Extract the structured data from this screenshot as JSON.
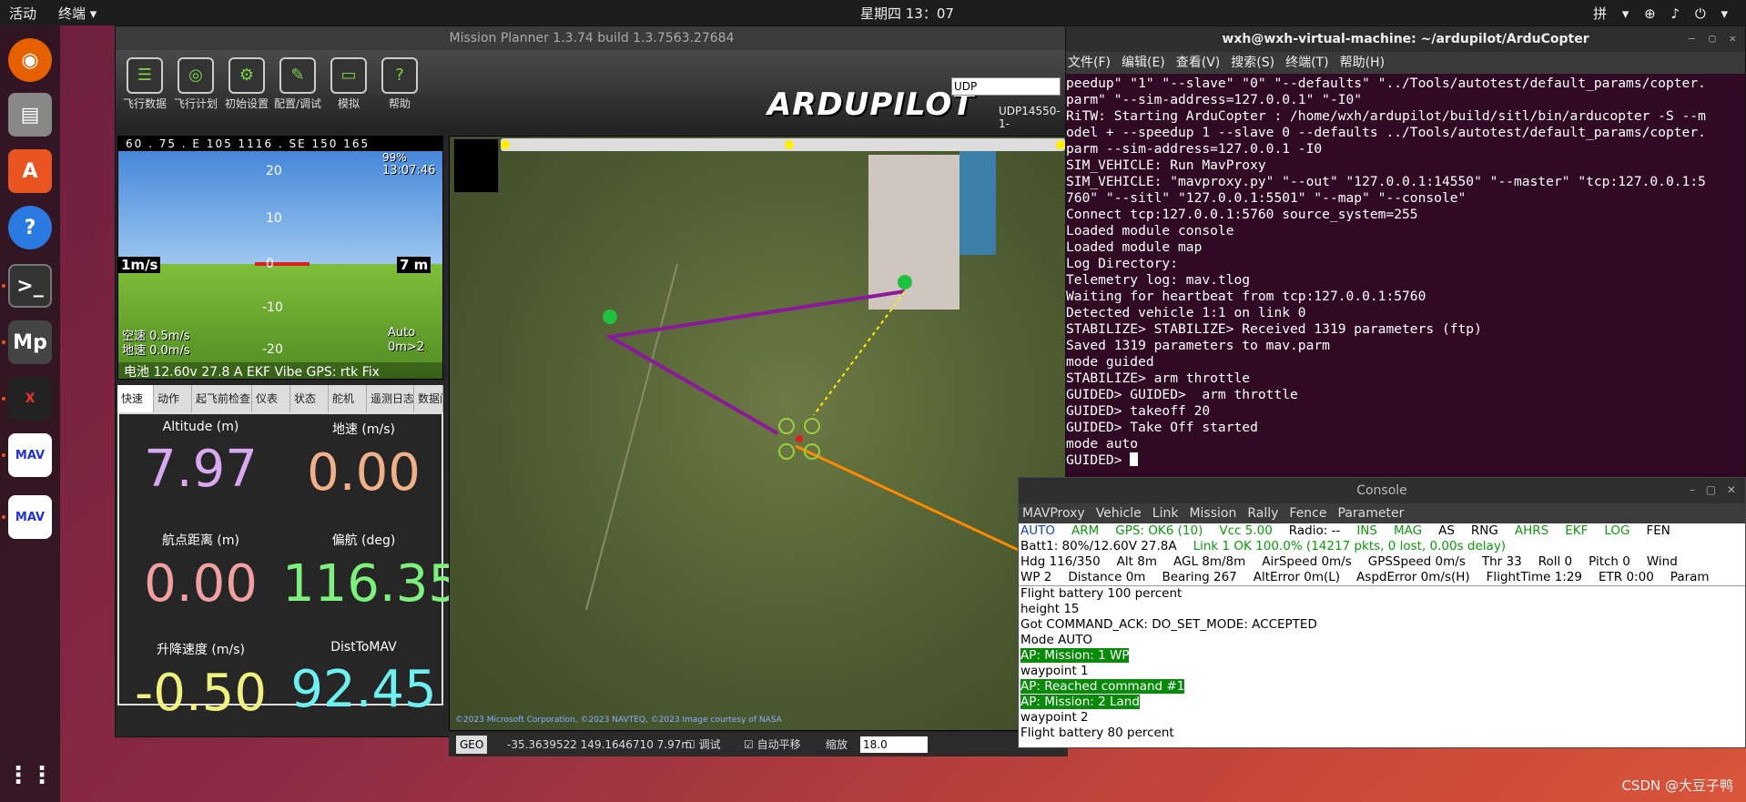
{
  "topbar": {
    "activities": "活动",
    "app": "终端 ▾",
    "clock": "星期四 13：07",
    "right": "拼 ▾  ⊕  ♪  ⏻ ▾"
  },
  "mp": {
    "title": "Mission Planner 1.3.74 build 1.3.7563.27684",
    "toolbar": [
      {
        "label": "飞行数据",
        "icon": "flight-data-icon"
      },
      {
        "label": "飞行计划",
        "icon": "flight-plan-icon"
      },
      {
        "label": "初始设置",
        "icon": "initial-setup-icon"
      },
      {
        "label": "配置/调试",
        "icon": "config-tuning-icon"
      },
      {
        "label": "模拟",
        "icon": "simulation-icon"
      },
      {
        "label": "帮助",
        "icon": "help-icon"
      }
    ],
    "logo": "ARDUPILOT",
    "conn_type": "UDP",
    "port": "UDP14550-1-"
  },
  "hud": {
    "compass": "60 . 75 . E 105 1116 . SE 150 165",
    "time": "13:07:46",
    "percent": "99%",
    "left_box": "1m/s",
    "right_box": "7 m",
    "airspeed": "空速 0.5m/s",
    "groundspeed": "地速 0.0m/s",
    "mode": "Auto",
    "wp": "0m>2",
    "bottom": "电池 12.60v 27.8 A EKF Vibe GPS: rtk Fix",
    "pitch_labels": [
      "20",
      "10",
      "0",
      "-10",
      "-20"
    ]
  },
  "tabs": [
    "快速",
    "动作",
    "起飞前检查",
    "仪表",
    "状态",
    "舵机",
    "遥测日志",
    "数据闪存"
  ],
  "quick": [
    {
      "label": "Altitude (m)",
      "value": "7.97",
      "color": "#d8a8f0"
    },
    {
      "label": "地速 (m/s)",
      "value": "0.00",
      "color": "#f0b088"
    },
    {
      "label": "航点距离 (m)",
      "value": "0.00",
      "color": "#f0a0a0"
    },
    {
      "label": "偏航 (deg)",
      "value": "116.35",
      "color": "#7ef07e"
    },
    {
      "label": "升降速度 (m/s)",
      "value": "-0.50",
      "color": "#f0f080"
    },
    {
      "label": "DistToMAV",
      "value": "92.45",
      "color": "#6ef0f0"
    }
  ],
  "map": {
    "attribution": "©2023 Microsoft Corporation, ©2023 NAVTEQ, ©2023 Image courtesy of NASA",
    "status": {
      "geo": "GEO",
      "coords": "-35.3639522 149.1646710  7.97m",
      "debug": "调试",
      "autopan": "自动平移",
      "zoom_label": "缩放",
      "zoom": "18.0"
    }
  },
  "terminal": {
    "title": "wxh@wxh-virtual-machine: ~/ardupilot/ArduCopter",
    "menu": [
      "文件(F)",
      "编辑(E)",
      "查看(V)",
      "搜索(S)",
      "终端(T)",
      "帮助(H)"
    ],
    "lines": [
      "peedup\" \"1\" \"--slave\" \"0\" \"--defaults\" \"../Tools/autotest/default_params/copter.",
      "parm\" \"--sim-address=127.0.0.1\" \"-I0\"",
      "RiTW: Starting ArduCopter : /home/wxh/ardupilot/build/sitl/bin/arducopter -S --m",
      "odel + --speedup 1 --slave 0 --defaults ../Tools/autotest/default_params/copter.",
      "parm --sim-address=127.0.0.1 -I0",
      "SIM_VEHICLE: Run MavProxy",
      "SIM_VEHICLE: \"mavproxy.py\" \"--out\" \"127.0.0.1:14550\" \"--master\" \"tcp:127.0.0.1:5",
      "760\" \"--sitl\" \"127.0.0.1:5501\" \"--map\" \"--console\"",
      "Connect tcp:127.0.0.1:5760 source_system=255",
      "Loaded module console",
      "Loaded module map",
      "Log Directory:",
      "Telemetry log: mav.tlog",
      "Waiting for heartbeat from tcp:127.0.0.1:5760",
      "Detected vehicle 1:1 on link 0",
      "STABILIZE> STABILIZE> Received 1319 parameters (ftp)",
      "Saved 1319 parameters to mav.parm",
      "mode guided",
      "STABILIZE> arm throttle",
      "GUIDED> GUIDED>  arm throttle",
      "GUIDED> takeoff 20",
      "GUIDED> Take Off started",
      "mode auto",
      "GUIDED> "
    ]
  },
  "console": {
    "title": "Console",
    "menu": [
      "MAVProxy",
      "Vehicle",
      "Link",
      "Mission",
      "Rally",
      "Fence",
      "Parameter"
    ],
    "status1": [
      {
        "t": "AUTO",
        "c": "blue"
      },
      {
        "t": "ARM",
        "c": "green"
      },
      {
        "t": "GPS: OK6 (10)",
        "c": "green"
      },
      {
        "t": "Vcc 5.00",
        "c": "green"
      },
      {
        "t": "Radio: --",
        "c": ""
      },
      {
        "t": "INS",
        "c": "green"
      },
      {
        "t": "MAG",
        "c": "green"
      },
      {
        "t": "AS",
        "c": ""
      },
      {
        "t": "RNG",
        "c": ""
      },
      {
        "t": "AHRS",
        "c": "green"
      },
      {
        "t": "EKF",
        "c": "green"
      },
      {
        "t": "LOG",
        "c": "green"
      },
      {
        "t": "FEN",
        "c": ""
      }
    ],
    "status2": "Batt1: 80%/12.60V 27.8A",
    "status2_link": "Link 1 OK 100.0% (14217 pkts, 0 lost, 0.00s delay)",
    "status3": [
      "Hdg 116/350",
      "Alt 8m",
      "AGL 8m/8m",
      "AirSpeed 0m/s",
      "GPSSpeed 0m/s",
      "Thr 33",
      "Roll 0",
      "Pitch 0",
      "Wind"
    ],
    "status4": [
      "WP 2",
      "Distance 0m",
      "Bearing 267",
      "AltError 0m(L)",
      "AspdError 0m/s(H)",
      "FlightTime 1:29",
      "ETR 0:00",
      "Param"
    ],
    "log": [
      {
        "t": "Flight battery 100 percent",
        "hl": false
      },
      {
        "t": "height 15",
        "hl": false
      },
      {
        "t": "Got COMMAND_ACK: DO_SET_MODE: ACCEPTED",
        "hl": false
      },
      {
        "t": "Mode AUTO",
        "hl": false
      },
      {
        "t": "AP: Mission: 1 WP",
        "hl": true
      },
      {
        "t": "waypoint 1",
        "hl": false
      },
      {
        "t": "AP: Reached command #1",
        "hl": true
      },
      {
        "t": "AP: Mission: 2 Land",
        "hl": true
      },
      {
        "t": "waypoint 2",
        "hl": false
      },
      {
        "t": "Flight battery 80 percent",
        "hl": false
      }
    ]
  },
  "watermark": "CSDN @大豆子鸭"
}
